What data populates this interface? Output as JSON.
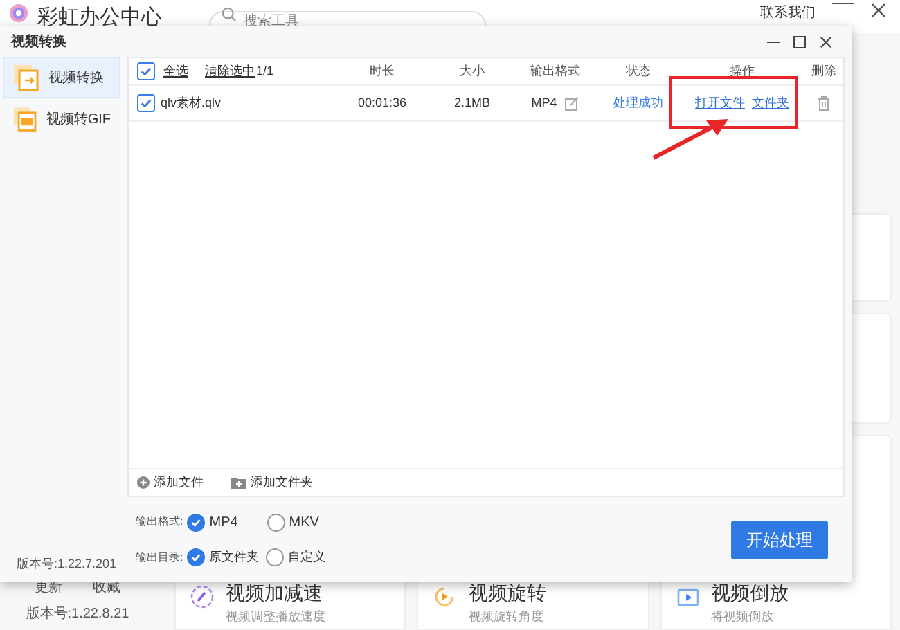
{
  "app": {
    "title": "彩虹办公中心",
    "search": {
      "placeholder": "搜索工具"
    },
    "contact": "联系我们",
    "footer_links": [
      "更新",
      "收藏"
    ],
    "version": "版本号:1.22.8.21",
    "tools": [
      {
        "name": "视频加减速",
        "desc": "视频调整播放速度",
        "kind": "speed"
      },
      {
        "name": "视频旋转",
        "desc": "视频旋转角度",
        "kind": "rotate"
      },
      {
        "name": "视频倒放",
        "desc": "将视频倒放",
        "kind": "reverse"
      }
    ]
  },
  "dialog": {
    "title": "视频转换",
    "sidebar": [
      {
        "label": "视频转换",
        "selected": true,
        "kind": "convert"
      },
      {
        "label": "视频转GIF",
        "selected": false,
        "kind": "gif"
      }
    ],
    "select_all": {
      "label": "全选",
      "checked": true
    },
    "clear": "清除选中",
    "count": "1/1",
    "columns": [
      "时长",
      "大小",
      "输出格式",
      "状态",
      "操作",
      "删除"
    ],
    "rows": [
      {
        "checked": true,
        "name": "qlv素材.qlv",
        "duration": "00:01:36",
        "size": "2.1MB",
        "format": "MP4",
        "status": "处理成功",
        "actions": [
          "打开文件",
          "文件夹"
        ]
      }
    ],
    "add_file": "添加文件",
    "add_folder": "添加文件夹",
    "format": {
      "label": "输出格式:",
      "options": [
        {
          "label": "MP4",
          "selected": true
        },
        {
          "label": "MKV",
          "selected": false
        }
      ]
    },
    "output": {
      "label": "输出目录:",
      "options": [
        {
          "label": "原文件夹",
          "selected": true
        },
        {
          "label": "自定义",
          "selected": false
        }
      ]
    },
    "start": "开始处理",
    "version": "版本号:1.22.7.201"
  }
}
